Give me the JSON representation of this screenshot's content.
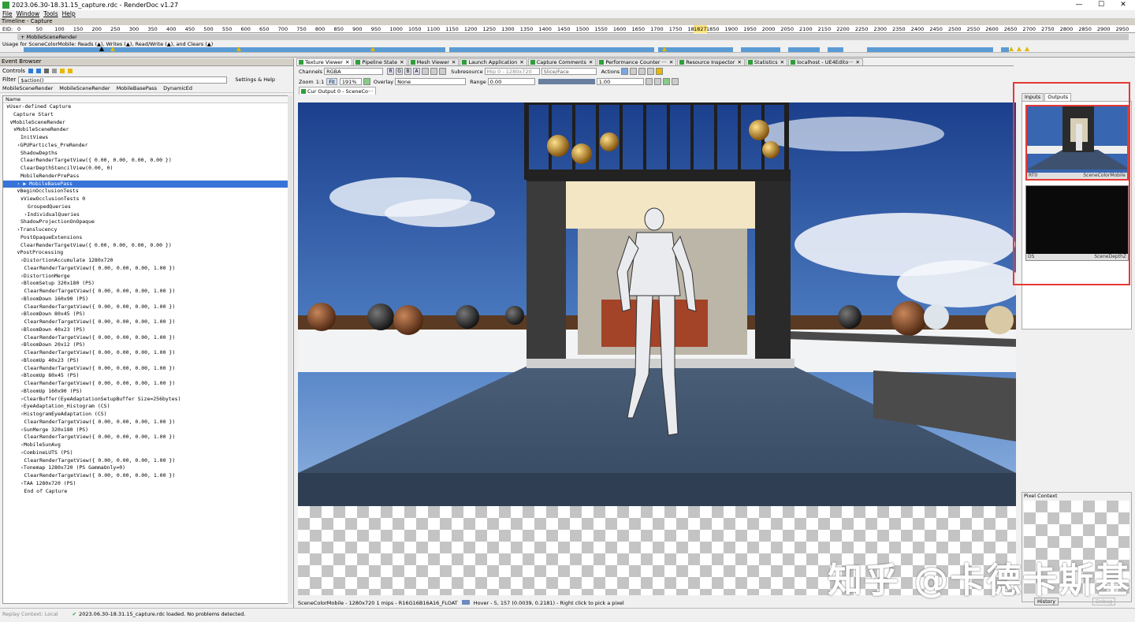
{
  "window": {
    "title": "2023.06.30-18.31.15_capture.rdc - RenderDoc v1.27",
    "controls": [
      "—",
      "☐",
      "✕"
    ]
  },
  "menu": [
    "File",
    "Window",
    "Tools",
    "Help"
  ],
  "timeline": {
    "header": "Timeline - Capture",
    "eid_label": "EID:",
    "ticks": [
      "0",
      "50",
      "100",
      "150",
      "200",
      "250",
      "300",
      "350",
      "400",
      "450",
      "500",
      "550",
      "600",
      "650",
      "700",
      "750",
      "800",
      "850",
      "900",
      "950",
      "1000",
      "1050",
      "1100",
      "1150",
      "1200",
      "1250",
      "1300",
      "1350",
      "1400",
      "1450",
      "1500",
      "1550",
      "1600",
      "1650",
      "1700",
      "1750",
      "1800",
      "1850",
      "1900",
      "1950",
      "2000",
      "2050",
      "2100",
      "2150",
      "2200",
      "2250",
      "2300",
      "2350",
      "2400",
      "2450",
      "2500",
      "2550",
      "2600",
      "2650",
      "2700",
      "2750",
      "2800",
      "2850",
      "2900",
      "2950"
    ],
    "marker": "1827",
    "section": "+ MobileSceneRender",
    "usage": "Usage for SceneColorMobile: Reads (▲), Writes (▲), Read/Write (▲), and Clears (▲)"
  },
  "event_browser": {
    "header": "Event Browser",
    "controls_label": "Controls",
    "filter_label": "Filter",
    "filter_value": "$action()",
    "settings_label": "Settings & Help",
    "breadcrumbs": [
      "MobileSceneRender",
      "MobileSceneRender",
      "MobileBasePass",
      "DynamicEd"
    ],
    "column": "Name",
    "rows": [
      {
        "text": "∨User-defined Capture",
        "indent": 0
      },
      {
        "text": "Capture Start",
        "indent": 2
      },
      {
        "text": "∨MobileSceneRender",
        "indent": 1
      },
      {
        "text": "∨MobileSceneRender",
        "indent": 2
      },
      {
        "text": "InitViews",
        "indent": 4
      },
      {
        "text": "›GPUParticles_PreRender",
        "indent": 3
      },
      {
        "text": "ShadowDepths",
        "indent": 4
      },
      {
        "text": "ClearRenderTargetView({ 0.00, 0.00, 0.00, 0.00 })",
        "indent": 4
      },
      {
        "text": "ClearDepthStencilView(0.00, 0)",
        "indent": 4
      },
      {
        "text": "MobileRenderPrePass",
        "indent": 4
      },
      {
        "text": "› ▶ MobileBasePass",
        "indent": 3,
        "sel": true
      },
      {
        "text": "∨BeginOcclusionTests",
        "indent": 3
      },
      {
        "text": "∨ViewOcclusionTests 0",
        "indent": 4
      },
      {
        "text": "GroupedQueries",
        "indent": 6
      },
      {
        "text": "›IndividualQueries",
        "indent": 5
      },
      {
        "text": "ShadowProjectionOnOpaque",
        "indent": 4
      },
      {
        "text": "›Translucency",
        "indent": 3
      },
      {
        "text": "PostOpaqueExtensions",
        "indent": 4
      },
      {
        "text": "ClearRenderTargetView({ 0.00, 0.00, 0.00, 0.00 })",
        "indent": 4
      },
      {
        "text": "∨PostProcessing",
        "indent": 3
      },
      {
        "text": "›DistortionAccumulate 1280x720",
        "indent": 4
      },
      {
        "text": "ClearRenderTargetView({ 0.00, 0.00, 0.00, 1.00 })",
        "indent": 5
      },
      {
        "text": "›DistortionMerge",
        "indent": 4
      },
      {
        "text": "›BloomSetup 320x180 (PS)",
        "indent": 4
      },
      {
        "text": "ClearRenderTargetView({ 0.00, 0.00, 0.00, 1.00 })",
        "indent": 5
      },
      {
        "text": "›BloomDown 160x90 (PS)",
        "indent": 4
      },
      {
        "text": "ClearRenderTargetView({ 0.00, 0.00, 0.00, 1.00 })",
        "indent": 5
      },
      {
        "text": "›BloomDown 80x45 (PS)",
        "indent": 4
      },
      {
        "text": "ClearRenderTargetView({ 0.00, 0.00, 0.00, 1.00 })",
        "indent": 5
      },
      {
        "text": "›BloomDown 40x23 (PS)",
        "indent": 4
      },
      {
        "text": "ClearRenderTargetView({ 0.00, 0.00, 0.00, 1.00 })",
        "indent": 5
      },
      {
        "text": "›BloomDown 20x12 (PS)",
        "indent": 4
      },
      {
        "text": "ClearRenderTargetView({ 0.00, 0.00, 0.00, 1.00 })",
        "indent": 5
      },
      {
        "text": "›BloomUp 40x23 (PS)",
        "indent": 4
      },
      {
        "text": "ClearRenderTargetView({ 0.00, 0.00, 0.00, 1.00 })",
        "indent": 5
      },
      {
        "text": "›BloomUp 80x45 (PS)",
        "indent": 4
      },
      {
        "text": "ClearRenderTargetView({ 0.00, 0.00, 0.00, 1.00 })",
        "indent": 5
      },
      {
        "text": "›BloomUp 160x90 (PS)",
        "indent": 4
      },
      {
        "text": "›ClearBuffer(EyeAdaptationSetupBuffer Size=256bytes)",
        "indent": 4
      },
      {
        "text": "›EyeAdaptation_Histogram (CS)",
        "indent": 4
      },
      {
        "text": "›HistogramEyeAdaptation (CS)",
        "indent": 4
      },
      {
        "text": "ClearRenderTargetView({ 0.00, 0.00, 0.00, 1.00 })",
        "indent": 5
      },
      {
        "text": "›SunMerge 320x180 (PS)",
        "indent": 4
      },
      {
        "text": "ClearRenderTargetView({ 0.00, 0.00, 0.00, 1.00 })",
        "indent": 5
      },
      {
        "text": "›MobileSunAvg",
        "indent": 4
      },
      {
        "text": "›CombineLUTS (PS)",
        "indent": 4
      },
      {
        "text": "ClearRenderTargetView({ 0.00, 0.00, 0.00, 1.00 })",
        "indent": 5
      },
      {
        "text": "›Tonemap 1280x720 (PS GammaOnly=0)",
        "indent": 4
      },
      {
        "text": "ClearRenderTargetView({ 0.00, 0.00, 0.00, 1.00 })",
        "indent": 5
      },
      {
        "text": "›TAA 1280x720 (PS)",
        "indent": 4
      },
      {
        "text": "End of Capture",
        "indent": 5
      }
    ]
  },
  "tabs": [
    "Texture Viewer",
    "Pipeline State",
    "Mesh Viewer",
    "Launch Application",
    "Capture Comments",
    "Performance Counter ···",
    "Resource Inspector",
    "Statistics",
    "localhost - UE4Edito···"
  ],
  "texture_viewer": {
    "channels_label": "Channels",
    "channels_value": "RGBA",
    "channel_buttons": [
      "R",
      "G",
      "B",
      "A"
    ],
    "subresource_label": "Subresource",
    "mip_value": "Mip 0 - 1280x720",
    "slice_value": "Slice/Face",
    "actions_label": "Actions",
    "zoom_label": "Zoom",
    "zoom_11": "1:1",
    "fit_label": "Fit",
    "zoom_value": "191%",
    "overlay_label": "Overlay",
    "overlay_value": "None",
    "range_label": "Range",
    "range_min": "0.00",
    "range_max": "1.00",
    "output_tab": "Cur Output 0 - SceneCo···",
    "status": "SceneColorMobile - 1280x720 1 mips - R16G16B16A16_FLOAT",
    "hover": "Hover -    5,  157 (0.0039, 0.2181) - Right click to pick a pixel"
  },
  "right_panel": {
    "tabs": [
      "Inputs",
      "Outputs"
    ],
    "thumbs": [
      {
        "slot": "RT0",
        "name": "SceneColorMobile"
      },
      {
        "slot": "DS",
        "name": "SceneDepthZ"
      }
    ],
    "pixel_context": "Pixel Context",
    "history_btn": "History",
    "debug_btn": "Debug"
  },
  "bottom": {
    "replay": "Replay Context: Local",
    "loaded": "2023.06.30-18.31.15_capture.rdc loaded. No problems detected."
  },
  "watermark": "知乎 @卡德卡斯基",
  "colors": {
    "accent": "#3874d8",
    "highlight": "#e53935"
  }
}
